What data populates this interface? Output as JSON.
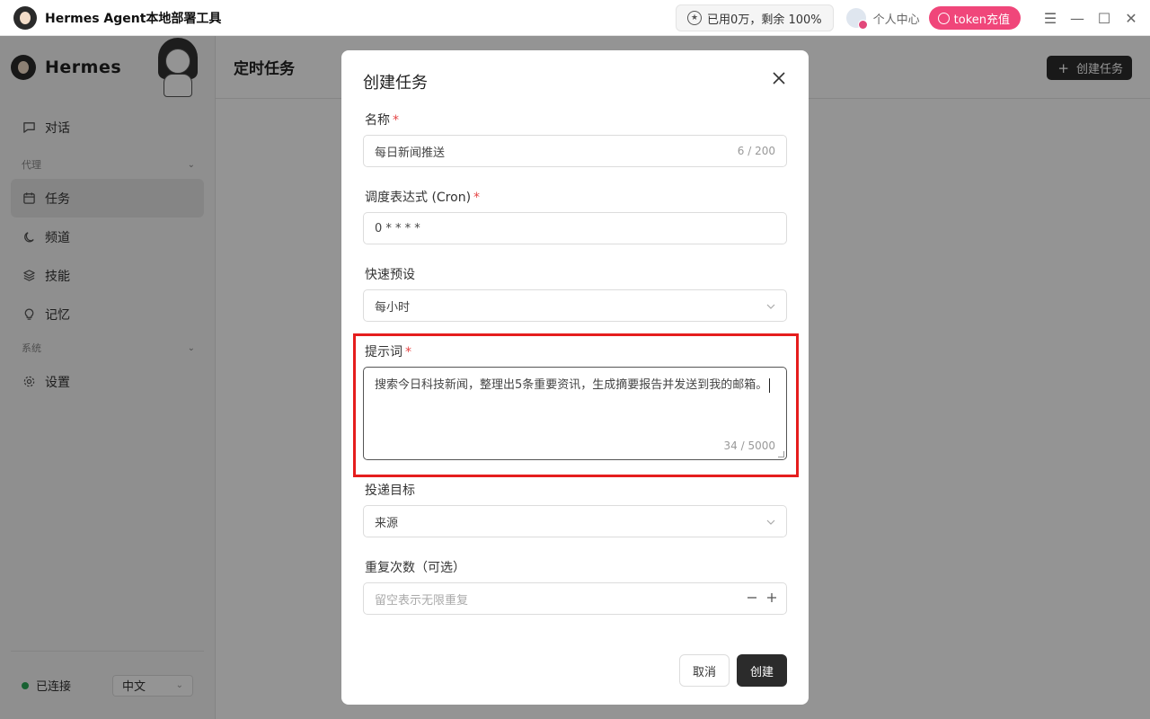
{
  "titlebar": {
    "app_title": "Hermes Agent本地部署工具",
    "usage_text": "已用0万，剩余 100%",
    "user_center_label": "个人中心",
    "token_button_label": "token充值"
  },
  "sidebar": {
    "brand_name": "Hermes",
    "items": [
      {
        "label": "对话",
        "icon": "chat-bubble-icon"
      },
      {
        "label": "任务",
        "icon": "calendar-icon"
      },
      {
        "label": "频道",
        "icon": "moon-icon"
      },
      {
        "label": "技能",
        "icon": "layers-icon"
      },
      {
        "label": "记忆",
        "icon": "lightbulb-icon"
      },
      {
        "label": "设置",
        "icon": "gear-icon"
      }
    ],
    "groups": {
      "agent": "代理",
      "system": "系统"
    },
    "status_label": "已连接",
    "status_color": "#2aa857",
    "language": "中文"
  },
  "main": {
    "page_title": "定时任务",
    "create_button_label": "创建任务"
  },
  "modal": {
    "title": "创建任务",
    "fields": {
      "name": {
        "label": "名称",
        "value": "每日新闻推送",
        "count": "6 / 200"
      },
      "cron": {
        "label": "调度表达式 (Cron)",
        "value": "0 * * * *"
      },
      "preset": {
        "label": "快速预设",
        "value": "每小时"
      },
      "prompt": {
        "label": "提示词",
        "value": "搜索今日科技新闻，整理出5条重要资讯，生成摘要报告并发送到我的邮箱。",
        "count": "34 / 5000"
      },
      "target": {
        "label": "投递目标",
        "value": "来源"
      },
      "repeat": {
        "label": "重复次数（可选）",
        "placeholder": "留空表示无限重复"
      }
    },
    "required_mark": "*",
    "cancel_label": "取消",
    "create_label": "创建"
  },
  "colors": {
    "token_button": "#f0467a",
    "highlight": "#e51d1d",
    "primary_button": "#2b2b2b"
  }
}
